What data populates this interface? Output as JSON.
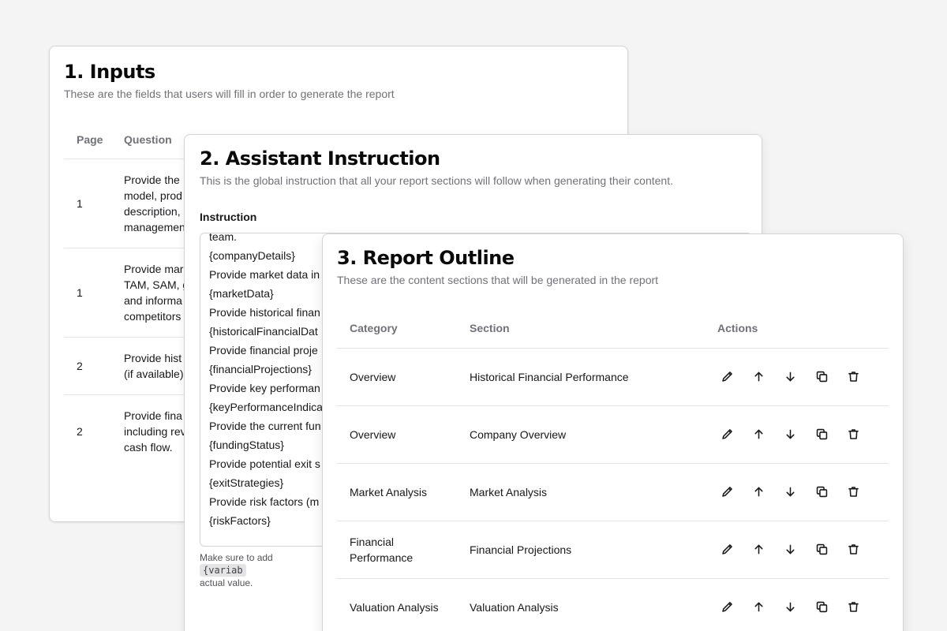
{
  "inputs": {
    "title": "1. Inputs",
    "subtitle": "These are the fields that users will fill in order to generate the report",
    "columns": {
      "page": "Page",
      "question": "Question"
    },
    "rows": [
      {
        "page": "1",
        "question": [
          "Provide the",
          "model, prod",
          "description,",
          "managemen"
        ]
      },
      {
        "page": "1",
        "question": [
          "Provide mar",
          "TAM, SAM, g",
          "and informa",
          "competitors"
        ]
      },
      {
        "page": "2",
        "question": [
          "Provide hist",
          "(if available)"
        ]
      },
      {
        "page": "2",
        "question": [
          "Provide fina",
          "including rev",
          "cash flow."
        ]
      }
    ]
  },
  "instruction": {
    "title": "2. Assistant Instruction",
    "subtitle": "This is the global instruction that all your report sections will follow when generating their content.",
    "label": "Instruction",
    "lines": [
      "team.",
      "{companyDetails}",
      "Provide market data in",
      "{marketData}",
      "Provide historical finan",
      "{historicalFinancialDat",
      "Provide financial proje",
      "{financialProjections}",
      "Provide key performan",
      "{keyPerformanceIndica",
      "Provide the current fun",
      "{fundingStatus}",
      "Provide potential exit s",
      "{exitStrategies}",
      "Provide risk factors (m",
      "{riskFactors}"
    ],
    "hint_prefix": "Make sure to add",
    "hint_code": "{variab",
    "hint_suffix": "actual value."
  },
  "outline": {
    "title": "3. Report Outline",
    "subtitle": "These are the content sections that will be generated in the report",
    "columns": {
      "category": "Category",
      "section": "Section",
      "actions": "Actions"
    },
    "rows": [
      {
        "category": "Overview",
        "section": "Historical Financial Performance"
      },
      {
        "category": "Overview",
        "section": "Company Overview"
      },
      {
        "category": "Market Analysis",
        "section": "Market Analysis"
      },
      {
        "category": "Financial Performance",
        "section": "Financial Projections"
      },
      {
        "category": "Valuation Analysis",
        "section": "Valuation Analysis"
      }
    ],
    "action_icons": [
      "pencil-icon",
      "arrow-up-icon",
      "arrow-down-icon",
      "copy-icon",
      "trash-icon"
    ]
  }
}
